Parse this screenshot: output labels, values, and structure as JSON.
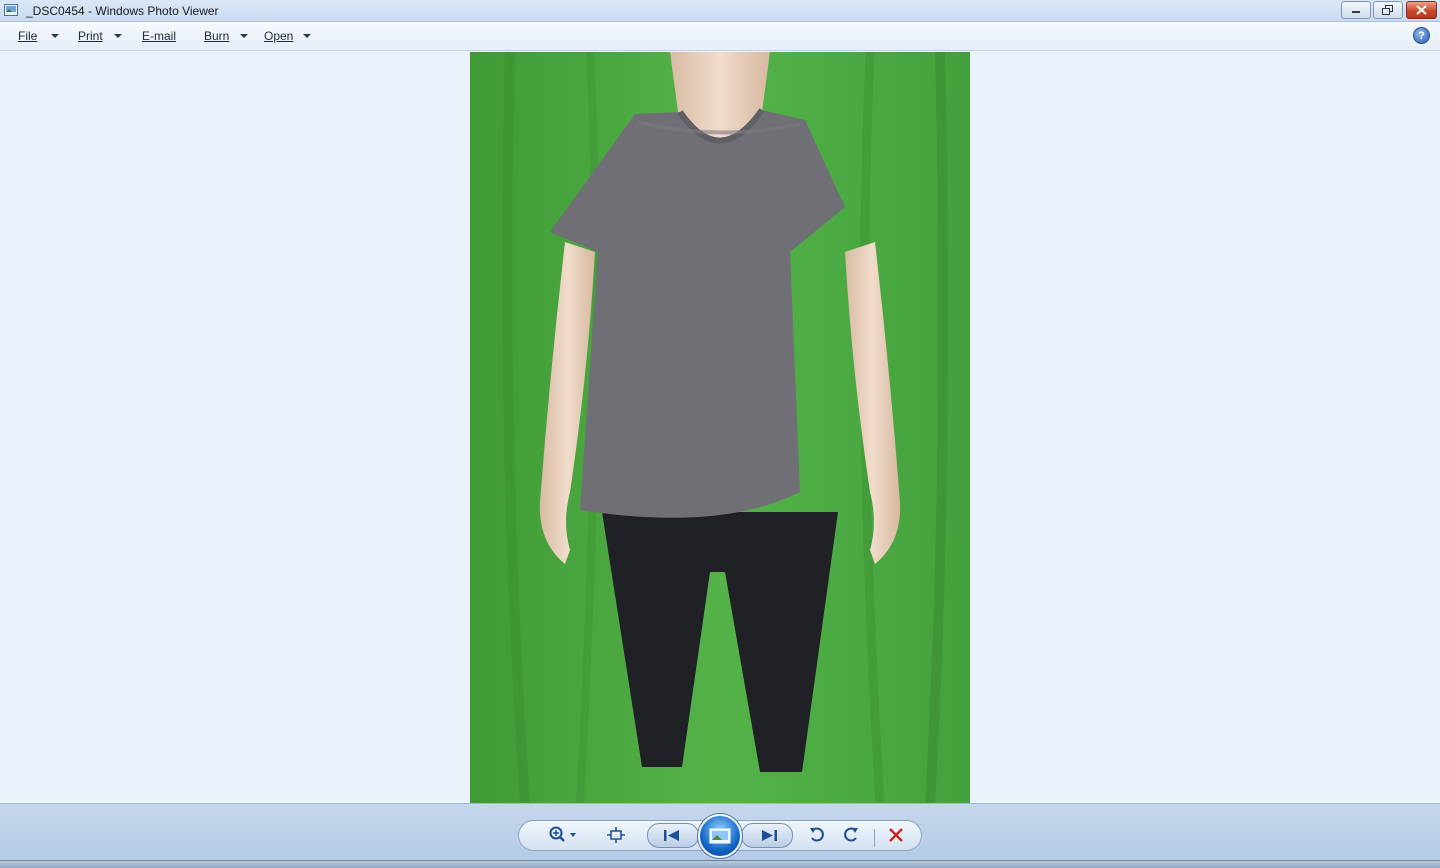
{
  "window": {
    "title": "_DSC0454 - Windows Photo Viewer"
  },
  "menu": {
    "items": [
      {
        "label": "File",
        "has_dropdown": true
      },
      {
        "label": "Print",
        "has_dropdown": true
      },
      {
        "label": "E-mail",
        "has_dropdown": false
      },
      {
        "label": "Burn",
        "has_dropdown": true
      },
      {
        "label": "Open",
        "has_dropdown": true
      }
    ],
    "help_symbol": "?"
  },
  "photo": {
    "background_color": "#4aa53f",
    "shirt_color": "#6f6f75",
    "pants_color": "#1f2125",
    "skin_color": "#e6cdb8"
  },
  "toolbar": {
    "icons": [
      "zoom-icon",
      "actual-size-icon",
      "previous-icon",
      "slideshow-icon",
      "next-icon",
      "rotate-counterclockwise-icon",
      "rotate-clockwise-icon",
      "delete-icon"
    ]
  },
  "colors": {
    "accent": "#1467c9",
    "delete": "#c8261b"
  }
}
